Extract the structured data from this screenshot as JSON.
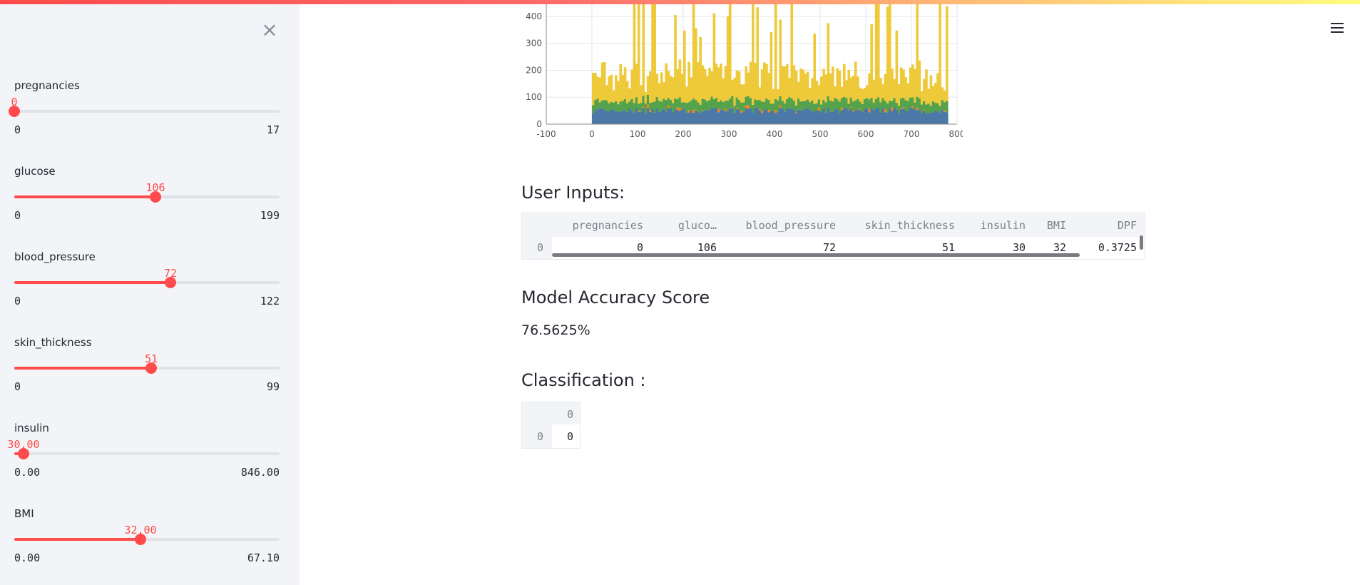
{
  "sidebar": {
    "sliders": [
      {
        "label": "pregnancies",
        "value": "0",
        "min": "0",
        "max": "17",
        "fraction": 0.0
      },
      {
        "label": "glucose",
        "value": "106",
        "min": "0",
        "max": "199",
        "fraction": 0.533
      },
      {
        "label": "blood_pressure",
        "value": "72",
        "min": "0",
        "max": "122",
        "fraction": 0.59
      },
      {
        "label": "skin_thickness",
        "value": "51",
        "min": "0",
        "max": "99",
        "fraction": 0.515
      },
      {
        "label": "insulin",
        "value": "30.00",
        "min": "0.00",
        "max": "846.00",
        "fraction": 0.035
      },
      {
        "label": "BMI",
        "value": "32.00",
        "min": "0.00",
        "max": "67.10",
        "fraction": 0.477
      }
    ]
  },
  "main": {
    "user_inputs_title": "User Inputs:",
    "user_inputs_table": {
      "headers": [
        "pregnancies",
        "gluco…",
        "blood_pressure",
        "skin_thickness",
        "insulin",
        "BMI",
        "DPF"
      ],
      "row_index": "0",
      "row": [
        "0",
        "106",
        "72",
        "51",
        "30",
        "32",
        "0.3725"
      ]
    },
    "accuracy_title": "Model Accuracy Score",
    "accuracy_value": "76.5625%",
    "classification_title": "Classification :",
    "classification_table": {
      "header": "0",
      "row_index": "0",
      "value": "0"
    }
  },
  "chart_data": {
    "type": "bar",
    "stacked": true,
    "xlim": [
      -100,
      800
    ],
    "x_ticks": [
      "-100",
      "0",
      "100",
      "200",
      "300",
      "400",
      "500",
      "600",
      "700",
      "800"
    ],
    "y_ticks": [
      "0",
      "100",
      "200",
      "300",
      "400"
    ],
    "series": [
      {
        "color": "#4c78a8",
        "typical": 45
      },
      {
        "color": "#f58518",
        "typical": 8
      },
      {
        "color": "#54a24b",
        "typical": 30
      },
      {
        "color": "#eeca3b",
        "typical": 150
      }
    ]
  }
}
